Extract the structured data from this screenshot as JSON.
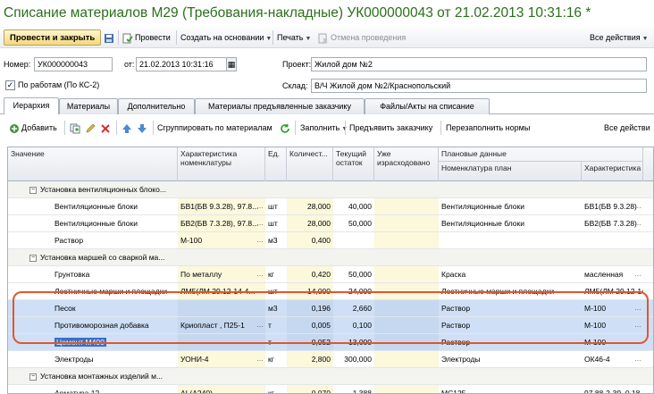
{
  "window": {
    "title": "Списание материалов М29 (Требования-накладные) УК000000043 от 21.02.2013 10:31:16 *"
  },
  "cmdbar": {
    "post_close": "Провести и закрыть",
    "post": "Провести",
    "create_based": "Создать на основании",
    "print": "Печать",
    "cancel_post": "Отмена проведения",
    "all_actions": "Все действия"
  },
  "form": {
    "number_label": "Номер:",
    "number_value": "УК000000043",
    "from_label": "от:",
    "date_value": "21.02.2013 10:31:16",
    "object_label": "Проект:",
    "object_value": "Жилой дом №2",
    "warehouse_label": "Склад:",
    "warehouse_value": "В/Ч Жилой дом №2/Краснопольский",
    "by_works_label": "По работам (По КС-2)",
    "by_works_checked": "✓"
  },
  "tabs": [
    {
      "label": "Иерархия"
    },
    {
      "label": "Материалы"
    },
    {
      "label": "Дополнительно"
    },
    {
      "label": "Материалы предъявленные заказчику"
    },
    {
      "label": "Файлы/Акты на списание"
    }
  ],
  "tbar": {
    "add": "Добавить",
    "group_by": "Сгруппировать по материалам",
    "fill": "Заполнить",
    "present": "Предъявить заказчику",
    "refill": "Перезаполнить нормы",
    "all_actions": "Все действи"
  },
  "grid": {
    "headers": {
      "value": "Значение",
      "char": "Характеристика номенклатуры",
      "unit": "Ед.",
      "qty": "Количест...",
      "stock": "Текущий остаток",
      "used": "Уже израсходовано",
      "plan": "Плановые данные",
      "plan_nom": "Номенклатура план",
      "plan_char": "Характеристика н"
    },
    "rows": [
      {
        "type": "group",
        "value": "Установка вентиляционных блоко...",
        "char": "",
        "unit": "",
        "qty": "",
        "stock": "",
        "plan_nom": "",
        "plan_char": ""
      },
      {
        "type": "item",
        "value": "Вентиляционные блоки",
        "char": "БВ1(БВ 9.3.28), 97.8...",
        "unit": "шт",
        "qty": "28,000",
        "stock": "40,000",
        "plan_nom": "Вентиляционные блоки",
        "plan_char": "БВ1(БВ 9.3.28)"
      },
      {
        "type": "item",
        "value": "Вентиляционные блоки",
        "char": "БВ2(БВ 7.3.28), 97.8...",
        "unit": "шт",
        "qty": "28,000",
        "stock": "50,000",
        "plan_nom": "Вентиляционные блоки",
        "plan_char": "БВ2(БВ 7.3.28)"
      },
      {
        "type": "item",
        "value": "Раствор",
        "char": "М-100",
        "unit": "м3",
        "qty": "0,400",
        "stock": "",
        "plan_nom": "",
        "plan_char": ""
      },
      {
        "type": "group",
        "value": "Установка маршей со сваркой ма...",
        "char": "",
        "unit": "",
        "qty": "",
        "stock": "",
        "plan_nom": "",
        "plan_char": ""
      },
      {
        "type": "item",
        "value": "Грунтовка",
        "char": "По металлу",
        "unit": "кг",
        "qty": "0,420",
        "stock": "50,000",
        "plan_nom": "Краска",
        "plan_char": "масленная"
      },
      {
        "type": "item",
        "value": "Лестничные марши и площадки",
        "char": "ЛМ5(ЛМ 29.12-14-4...",
        "unit": "шт",
        "qty": "14,000",
        "stock": "24,000",
        "plan_nom": "Лестничные марши и площадки",
        "plan_char": "ЛМ5(ЛМ 29.12-14"
      },
      {
        "type": "sel",
        "value": "Песок",
        "char": "",
        "unit": "м3",
        "qty": "0,196",
        "stock": "2,660",
        "plan_nom": "Раствор",
        "plan_char": "М-100"
      },
      {
        "type": "sel",
        "value": "Противоморозная добавка",
        "char": "Криопласт , П25-1",
        "unit": "т",
        "qty": "0,005",
        "stock": "0,100",
        "plan_nom": "Раствор",
        "plan_char": "М-100"
      },
      {
        "type": "sel",
        "value": "Цемент М400",
        "char": "",
        "unit": "т",
        "qty": "0,052",
        "stock": "13,000",
        "plan_nom": "Раствор",
        "plan_char": "М-100"
      },
      {
        "type": "item",
        "value": "Электроды",
        "char": "УОНИ-4",
        "unit": "кг",
        "qty": "2,800",
        "stock": "300,000",
        "plan_nom": "Электроды",
        "plan_char": "ОК46-4"
      },
      {
        "type": "group",
        "value": "Установка монтажных изделий м...",
        "char": "",
        "unit": "",
        "qty": "",
        "stock": "",
        "plan_nom": "",
        "plan_char": ""
      },
      {
        "type": "item",
        "value": "Арматура 12",
        "char": "AI (A240)",
        "unit": "кг",
        "qty": "0,070",
        "stock": "1,388",
        "plan_nom": "МС125",
        "plan_char": "97.88-2-39, 0,18"
      }
    ]
  },
  "colors": {
    "title": "#2a6f1a",
    "highlight": "#e2562a",
    "selection": "#cfe0f6"
  }
}
